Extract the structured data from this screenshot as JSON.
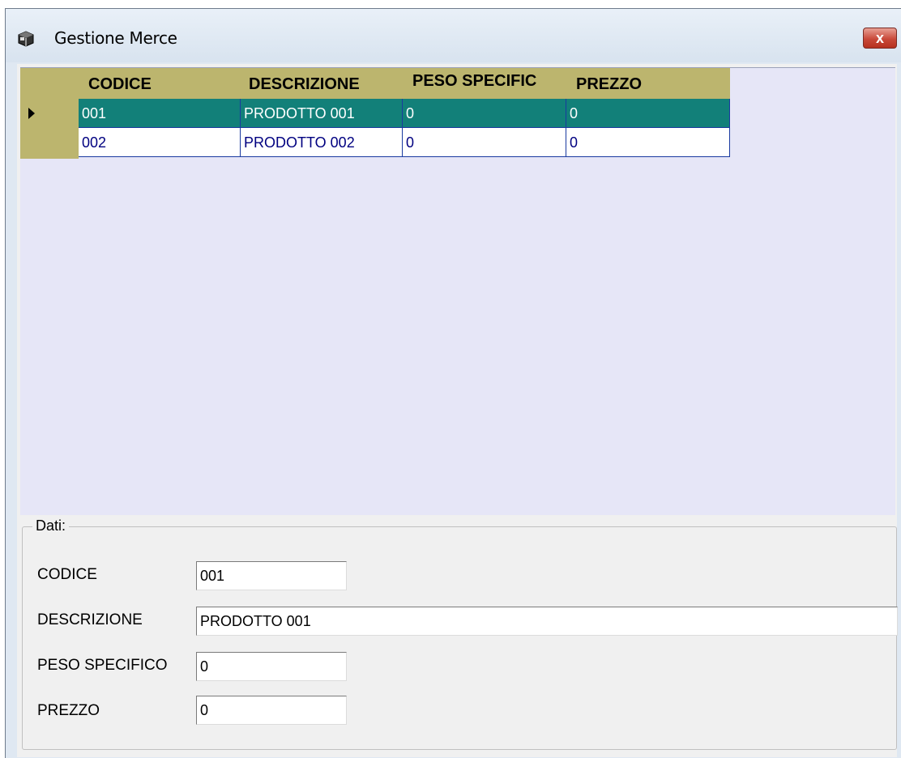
{
  "window": {
    "title": "Gestione Merce",
    "close_label": "x",
    "icon": "box-icon"
  },
  "grid": {
    "columns": [
      "CODICE",
      "DESCRIZIONE",
      "PESO SPECIFIC",
      "PREZZO"
    ],
    "rows": [
      [
        "001",
        "PRODOTTO 001",
        "0",
        "0"
      ],
      [
        "002",
        "PRODOTTO 002",
        "0",
        "0"
      ]
    ],
    "selected_row": 0,
    "colors": {
      "header": "#bcb56e",
      "selected": "#128079",
      "background": "#e6e6f7"
    }
  },
  "form": {
    "group_label": "Dati:",
    "fields": [
      {
        "label": "CODICE",
        "value": "001"
      },
      {
        "label": "DESCRIZIONE",
        "value": "PRODOTTO 001"
      },
      {
        "label": "PESO SPECIFICO",
        "value": "0"
      },
      {
        "label": "PREZZO",
        "value": "0"
      }
    ]
  }
}
